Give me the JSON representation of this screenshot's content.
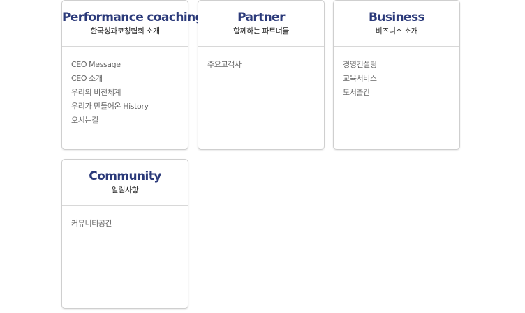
{
  "cards": [
    {
      "title": "Performance coaching",
      "subtitle": "한국성과코칭협회 소개",
      "links": [
        "CEO Message",
        "CEO 소개",
        "우리의 비전체계",
        "우리가 만들어온 History",
        "오시는길"
      ]
    },
    {
      "title": "Partner",
      "subtitle": "함께하는 파트너들",
      "links": [
        "주요고객사"
      ]
    },
    {
      "title": "Business",
      "subtitle": "비즈니스 소개",
      "links": [
        "경영컨설팅",
        "교육서비스",
        "도서출간"
      ]
    },
    {
      "title": "Community",
      "subtitle": "알림사항",
      "links": [
        "커뮤니티공간"
      ]
    }
  ],
  "colors": {
    "title": "#2b3a7a",
    "link": "#666666",
    "border": "#cfcfcf"
  }
}
